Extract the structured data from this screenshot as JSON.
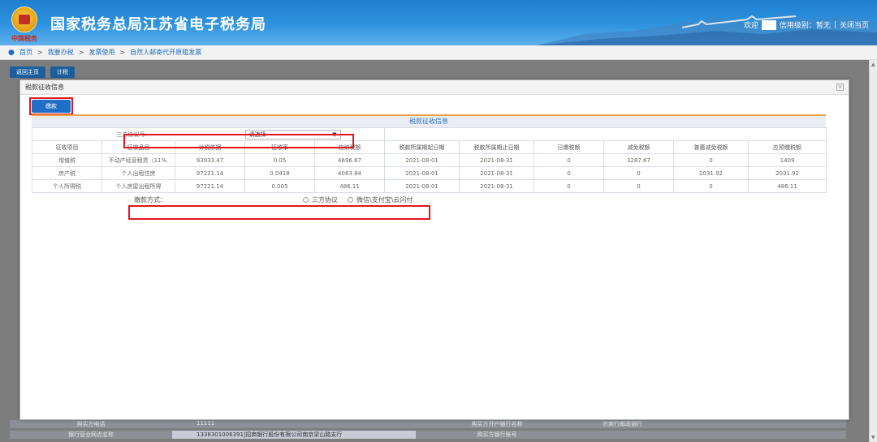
{
  "header": {
    "site_title": "国家税务总局江苏省电子税务局",
    "emblem_sub": "中国税务",
    "welcome": "欢迎",
    "credit_label": "信用级别：暂无",
    "divider": "|",
    "close_page": "关闭当页"
  },
  "breadcrumb": {
    "items": [
      "首页",
      "我要办税",
      "发票使用",
      "自然人邮寄代开原租发票"
    ],
    "separator": ">"
  },
  "background_page": {
    "buttons": [
      "返回主页",
      "计税"
    ],
    "rows": [
      {
        "label": "购买方电话",
        "value": "11111",
        "right_label": "购买方开户银行名称",
        "right_value": "农商行邮政银行"
      },
      {
        "label": "银行营业网点名称",
        "value": "1338301006391|招商银行股份有限公司南京梁山路支行",
        "right_label": "购买方银行账号",
        "right_value": ""
      }
    ]
  },
  "dialog": {
    "title": "税款征收信息",
    "pay_button": "缴款",
    "section_title": "税款征收信息",
    "agreement_label": "三方协议号:",
    "agreement_select": "请选择",
    "columns": [
      "征收项目",
      "征收品目",
      "计税依据",
      "征收率",
      "应纳税额",
      "税款所属期起日期",
      "税款所属期止日期",
      "已缴税额",
      "减免税额",
      "普惠减免税额",
      "应预缴税额"
    ],
    "rows": [
      [
        "增值税",
        "不动产经营租赁（11%.",
        "93933.47",
        "0.05",
        "4696.67",
        "2021-08-01",
        "2021-08-31",
        "0",
        "3287.67",
        "0",
        "1409"
      ],
      [
        "房产税",
        "个人出租住房",
        "97221.14",
        "0.0418",
        "4063.84",
        "2021-08-01",
        "2021-08-31",
        "0",
        "0",
        "2031.92",
        "2031.92"
      ],
      [
        "个人所得税",
        "个人房屋出租所得",
        "97221.14",
        "0.005",
        "486.11",
        "2021-08-01",
        "2021-08-31",
        "0",
        "0",
        "0",
        "486.11"
      ]
    ],
    "pay_mode_label": "缴款方式：",
    "pay_options": [
      "三方协议",
      "微信\\支付宝\\云闪付"
    ]
  },
  "colors": {
    "header_blue": "#2f93df",
    "accent_orange": "#f0a24a",
    "highlight_red": "#e0161e",
    "button_blue": "#1f6fc6"
  }
}
